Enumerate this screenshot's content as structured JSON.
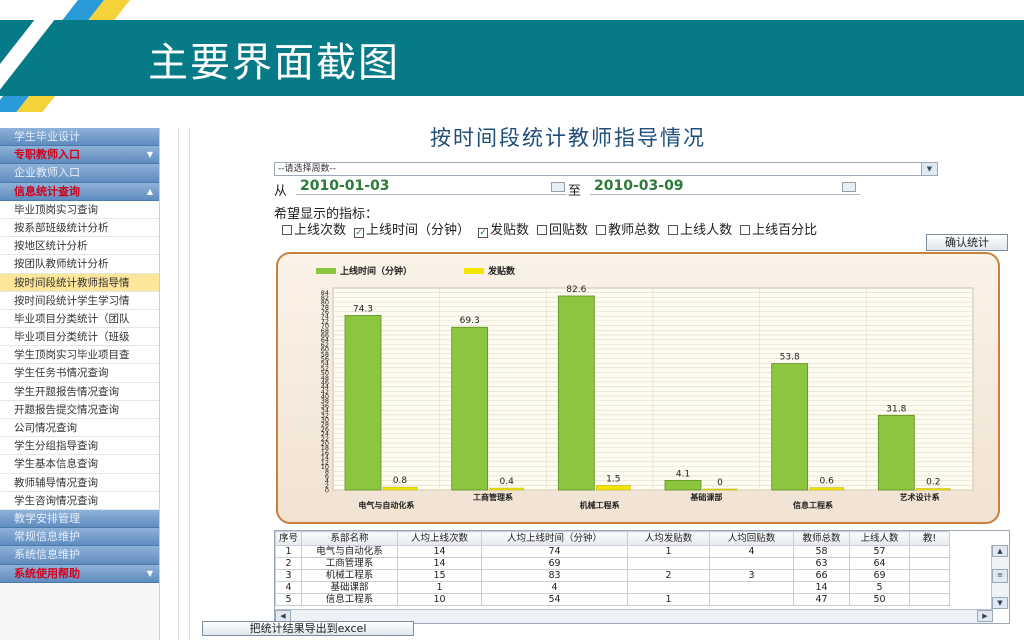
{
  "slide": {
    "title": "主要界面截图"
  },
  "sidebar": {
    "items": [
      {
        "label": "学生毕业设计",
        "kind": "blue"
      },
      {
        "label": "专职教师入口",
        "kind": "red",
        "arrow": "▼"
      },
      {
        "label": "企业教师入口",
        "kind": "blue"
      },
      {
        "label": "信息统计查询",
        "kind": "red",
        "arrow": "▲"
      },
      {
        "label": "毕业顶岗实习查询",
        "kind": "sub"
      },
      {
        "label": "按系部班级统计分析",
        "kind": "sub"
      },
      {
        "label": "按地区统计分析",
        "kind": "sub"
      },
      {
        "label": "按团队教师统计分析",
        "kind": "sub"
      },
      {
        "label": "按时间段统计教师指导情",
        "kind": "sub",
        "active": true
      },
      {
        "label": "按时间段统计学生学习情",
        "kind": "sub"
      },
      {
        "label": "毕业项目分类统计（团队",
        "kind": "sub"
      },
      {
        "label": "毕业项目分类统计（班级",
        "kind": "sub"
      },
      {
        "label": "学生顶岗实习毕业项目查",
        "kind": "sub"
      },
      {
        "label": "学生任务书情况查询",
        "kind": "sub"
      },
      {
        "label": "学生开题报告情况查询",
        "kind": "sub"
      },
      {
        "label": "开题报告提交情况查询",
        "kind": "sub"
      },
      {
        "label": "公司情况查询",
        "kind": "sub"
      },
      {
        "label": "学生分组指导查询",
        "kind": "sub"
      },
      {
        "label": "学生基本信息查询",
        "kind": "sub"
      },
      {
        "label": "教师辅导情况查询",
        "kind": "sub"
      },
      {
        "label": "学生咨询情况查询",
        "kind": "sub"
      },
      {
        "label": "教学安排管理",
        "kind": "blue"
      },
      {
        "label": "常规信息维护",
        "kind": "blue"
      },
      {
        "label": "系统信息维护",
        "kind": "blue"
      },
      {
        "label": "系统使用帮助",
        "kind": "red",
        "arrow": "▼"
      }
    ]
  },
  "main": {
    "title": "按时间段统计教师指导情况",
    "week_select": "--请选择周数--",
    "from_label": "从",
    "to_label": "至",
    "date_from": "2010-01-03",
    "date_to": "2010-03-09",
    "metrics_label": "希望显示的指标：",
    "metrics": [
      {
        "label": "上线次数",
        "checked": false
      },
      {
        "label": "上线时间（分钟）",
        "checked": true
      },
      {
        "label": "发贴数",
        "checked": true
      },
      {
        "label": "回贴数",
        "checked": false
      },
      {
        "label": "教师总数",
        "checked": false
      },
      {
        "label": "上线人数",
        "checked": false
      },
      {
        "label": "上线百分比",
        "checked": false
      }
    ],
    "confirm_button": "确认统计",
    "export_button": "把统计结果导出到excel"
  },
  "chart_data": {
    "type": "bar",
    "categories": [
      "电气与自动化系",
      "工商管理系",
      "机械工程系",
      "基础课部",
      "信息工程系",
      "艺术设计系"
    ],
    "series": [
      {
        "name": "上线时间（分钟）",
        "values": [
          74.3,
          69.3,
          82.6,
          4.1,
          53.8,
          31.8
        ],
        "color": "#8cc63f"
      },
      {
        "name": "发贴数",
        "values": [
          0.8,
          0.4,
          1.5,
          0,
          0.6,
          0.2
        ],
        "color": "#f2e600"
      }
    ],
    "ylim": [
      0,
      86
    ],
    "yticks": [
      0,
      2,
      4,
      6,
      8,
      10,
      12,
      14,
      16,
      18,
      20,
      22,
      24,
      26,
      28,
      30,
      32,
      34,
      36,
      38,
      40,
      42,
      44,
      46,
      48,
      50,
      52,
      54,
      56,
      58,
      60,
      62,
      64,
      66,
      68,
      70,
      72,
      74,
      76,
      78,
      80,
      82,
      84
    ],
    "grid": true,
    "legend": "top-left"
  },
  "table": {
    "headers": [
      "序号",
      "系部名称",
      "人均上线次数",
      "人均上线时间（分钟）",
      "人均发贴数",
      "人均回贴数",
      "教师总数",
      "上线人数",
      "教!"
    ],
    "rows": [
      [
        "1",
        "电气与自动化系",
        "14",
        "74",
        "1",
        "4",
        "58",
        "57",
        ""
      ],
      [
        "2",
        "工商管理系",
        "14",
        "69",
        "",
        "",
        "63",
        "64",
        ""
      ],
      [
        "3",
        "机械工程系",
        "15",
        "83",
        "2",
        "3",
        "66",
        "69",
        ""
      ],
      [
        "4",
        "基础课部",
        "1",
        "4",
        "",
        "",
        "14",
        "5",
        ""
      ],
      [
        "5",
        "信息工程系",
        "10",
        "54",
        "1",
        "",
        "47",
        "50",
        ""
      ]
    ]
  }
}
